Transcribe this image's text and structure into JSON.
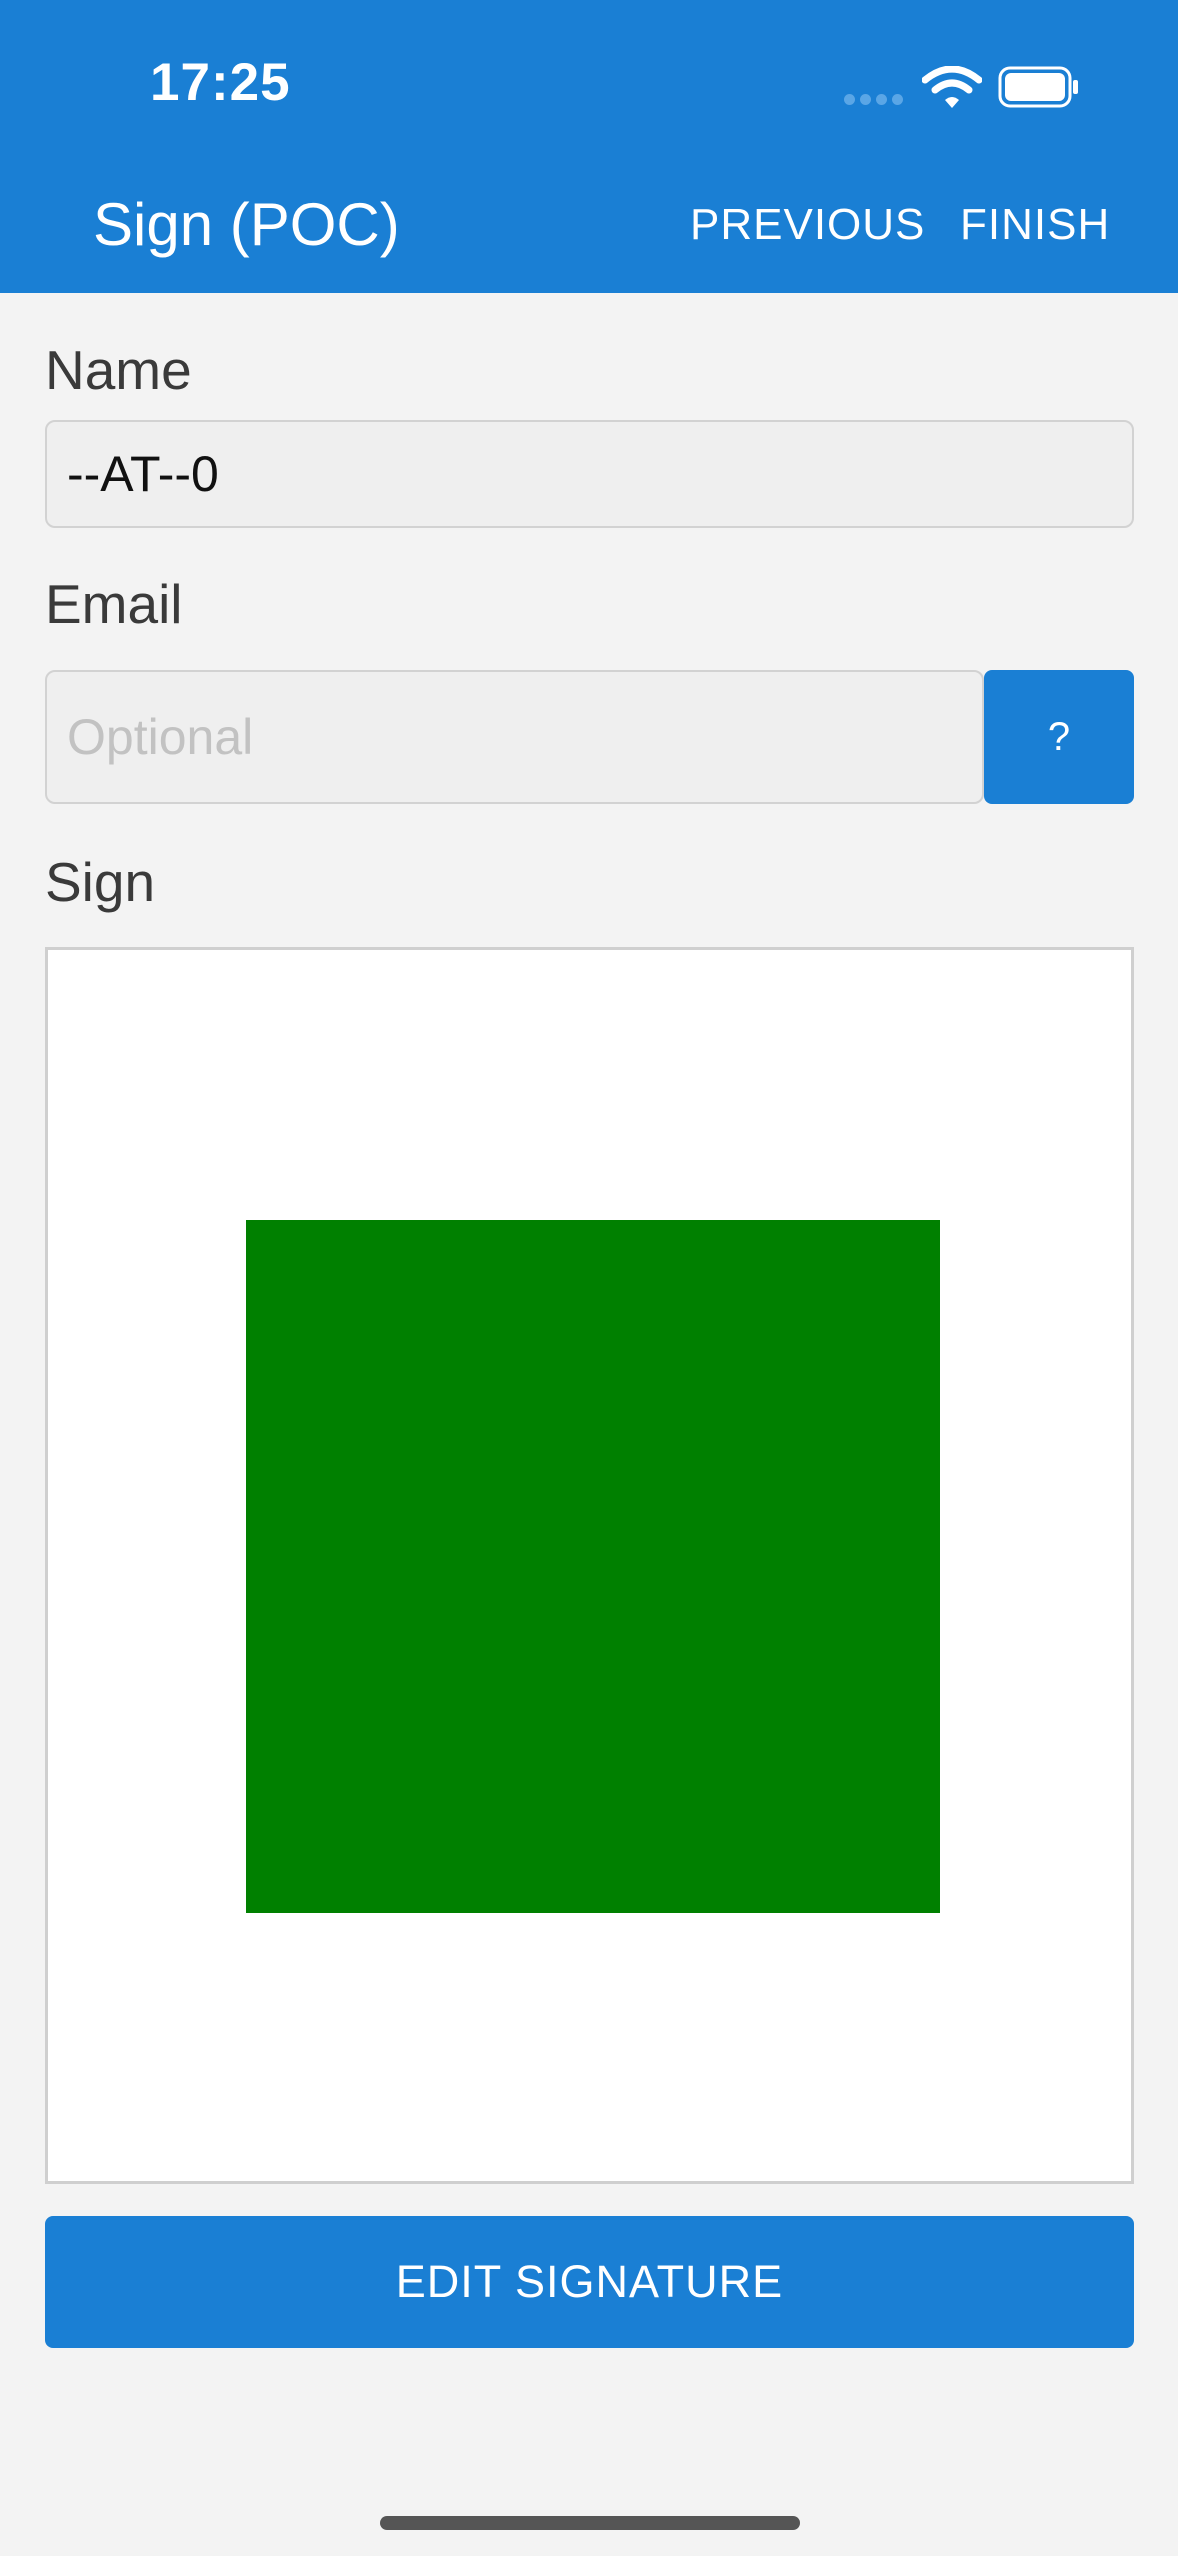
{
  "status_bar": {
    "time": "17:25",
    "icons": [
      "signal-dots-icon",
      "wifi-icon",
      "battery-icon"
    ]
  },
  "header": {
    "title": "Sign (POC)",
    "previous_label": "PREVIOUS",
    "finish_label": "FINISH"
  },
  "form": {
    "name_label": "Name",
    "name_value": "--AT--0",
    "email_label": "Email",
    "email_value": "",
    "email_placeholder": "Optional",
    "help_label": "?",
    "sign_label": "Sign",
    "edit_signature_label": "EDIT SIGNATURE"
  },
  "colors": {
    "accent": "#1a7fd4",
    "background": "#f3f3f3",
    "signature_fill": "#008000"
  }
}
